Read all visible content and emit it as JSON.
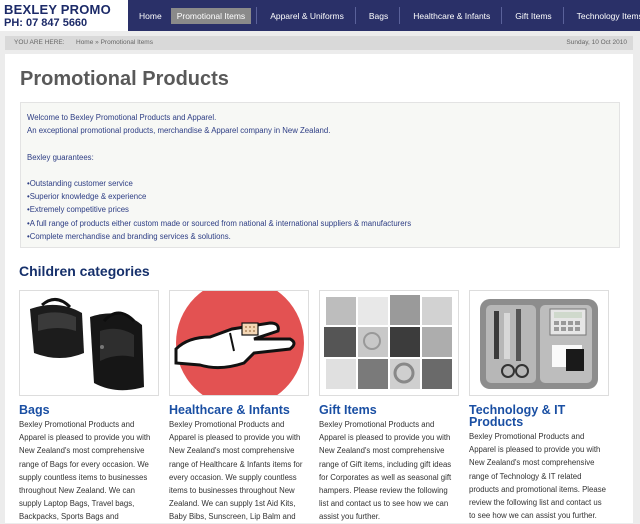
{
  "header": {
    "logo_name": "BEXLEY PROMO",
    "logo_phone": "PH: 07 847 5660",
    "nav": [
      {
        "label": "Home",
        "active": false
      },
      {
        "label": "Promotional Items",
        "active": true
      },
      {
        "label": "Apparel & Uniforms",
        "active": false
      },
      {
        "label": "Bags",
        "active": false
      },
      {
        "label": "Healthcare & Infants",
        "active": false
      },
      {
        "label": "Gift Items",
        "active": false
      },
      {
        "label": "Technology Items",
        "active": false
      }
    ]
  },
  "breadcrumb": {
    "label": "YOU ARE HERE:",
    "home": "Home",
    "separator": "»",
    "current": "Promotional Items",
    "date": "Sunday, 10 Oct 2010"
  },
  "main": {
    "title": "Promotional Products",
    "intro_lines": [
      "Welcome to Bexley Promotional Products and Apparel.",
      "An exceptional promotional products, merchandise & Apparel company in New Zealand."
    ],
    "guarantees_label": "Bexley guarantees:",
    "guarantees": [
      "Outstanding customer service",
      "Superior knowledge & experience",
      "Extremely competitive prices",
      "A full range of products either custom made or sourced from national & international suppliers & manufacturers",
      "Complete merchandise and branding services & solutions."
    ],
    "children_title": "Children categories",
    "categories": [
      {
        "title": "Bags",
        "icon": "backpack-photo",
        "text": "Bexley Promotional Products and Apparel is pleased to provide you with New Zealand's most comprehensive range of Bags for every occasion. We supply countless items to businesses throughout New Zealand. We can supply Laptop Bags, Travel bags, Backpacks, Sports Bags and"
      },
      {
        "title": "Healthcare & Infants",
        "icon": "bandage-photo",
        "text": "Bexley Promotional Products and Apparel is pleased to provide you with New Zealand's most comprehensive range of Healthcare & Infants items for every occasion. We supply countless items to businesses throughout New Zealand. We can supply 1st Aid Kits, Baby Bibs, Sunscreen, Lip Balm and"
      },
      {
        "title": "Gift Items",
        "icon": "gift-collage-photo",
        "text": "Bexley Promotional Products and Apparel is pleased to provide you with New Zealand's most comprehensive range of Gift items, including gift ideas for Corporates as well as seasonal gift hampers. Please review the following list and contact us to see how we can assist you further."
      },
      {
        "title": "Technology & IT Products",
        "icon": "tech-kit-photo",
        "text": "Bexley Promotional Products and Apparel is pleased to provide you with New Zealand's most comprehensive range of Technology & IT related products and promotional items. Please review the following list and contact us to see how we can assist you further."
      }
    ]
  }
}
